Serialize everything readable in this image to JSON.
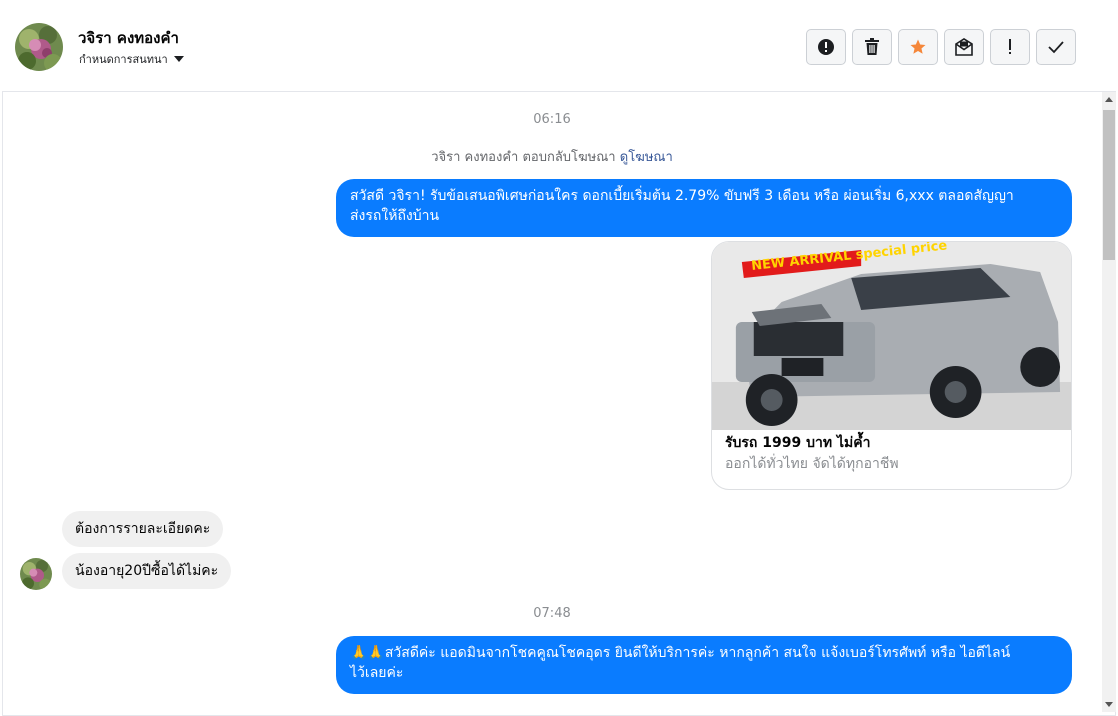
{
  "header": {
    "contact_name": "วจิรา คงทองคำ",
    "assign_label": "กำหนดการสนทนา",
    "toolbar": [
      {
        "icon": "alert-circle-icon"
      },
      {
        "icon": "trash-icon"
      },
      {
        "icon": "star-icon"
      },
      {
        "icon": "mail-icon"
      },
      {
        "icon": "exclamation-icon"
      },
      {
        "icon": "check-icon"
      }
    ]
  },
  "colors": {
    "outgoing_bubble": "#0a7cff",
    "incoming_bubble": "#f0f0f0",
    "star": "#f5873a",
    "link": "#385898"
  },
  "conversation": {
    "time_1": "06:16",
    "ad_reply_prefix": "วจิรา คงทองคำ ตอบกลับโฆษณา",
    "ad_reply_link": "ดูโฆษณา",
    "out_1_line1": "สวัสดี วจิรา! รับข้อเสนอพิเศษก่อนใคร ดอกเบี้ยเริ่มต้น 2.79%  ขับฟรี 3 เดือน หรือ ผ่อนเริ่ม 6,xxx ตลอดสัญญา",
    "out_1_line2": "ส่งรถให้ถึงบ้าน",
    "card": {
      "image_text": "NEW ARRIVAL special price",
      "title": "รับรถ 1999 บาท ไม่ค้ำ",
      "subtitle": "ออกได้ทั่วไทย จัดได้ทุกอาชีพ"
    },
    "in_1": "ต้องการรายละเอียดคะ",
    "in_2": "น้องอายุ20ปีซื้อได้ไม่คะ",
    "time_2": "07:48",
    "out_2_line1": "🙏🙏สวัสดีค่ะ แอดมินจากโชคคูณโชคอุดร ยินดีให้บริการค่ะ หากลูกค้า สนใจ แจ้งเบอร์โทรศัพท์ หรือ ไอดีไลน์",
    "out_2_line2": "ไว้เลยค่ะ"
  }
}
